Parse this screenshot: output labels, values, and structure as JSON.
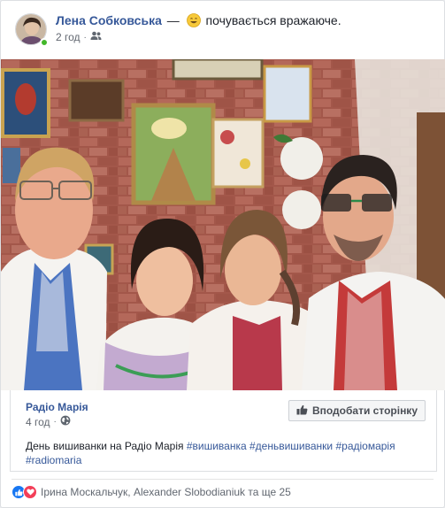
{
  "post": {
    "author": "Лена Собковська",
    "dash": "—",
    "feeling": "почувається вражаюче.",
    "time": "2 год",
    "audience_icon": "friends-icon",
    "emoji_icon": "smiling-emoji-icon"
  },
  "shared": {
    "page_name": "Радіо Марія",
    "time": "4 год",
    "audience_icon": "globe-icon",
    "like_button_label": "Вподобати сторінку",
    "text_prefix": "День вишиванки на Радіо Марія ",
    "hashtags": [
      "#вишиванка",
      "#деньвишиванки",
      "#радіомарія",
      "#radiomaria"
    ]
  },
  "reactions": {
    "icons": [
      "like-reaction-icon",
      "love-reaction-icon"
    ],
    "summary": "Ірина Москальчук, Alexander Slobodianiuk та ще 25"
  },
  "colors": {
    "link": "#365899",
    "secondary_text": "#616770",
    "like_blue": "#1877f2",
    "love_red": "#f33e58",
    "online_green": "#42b72a"
  }
}
